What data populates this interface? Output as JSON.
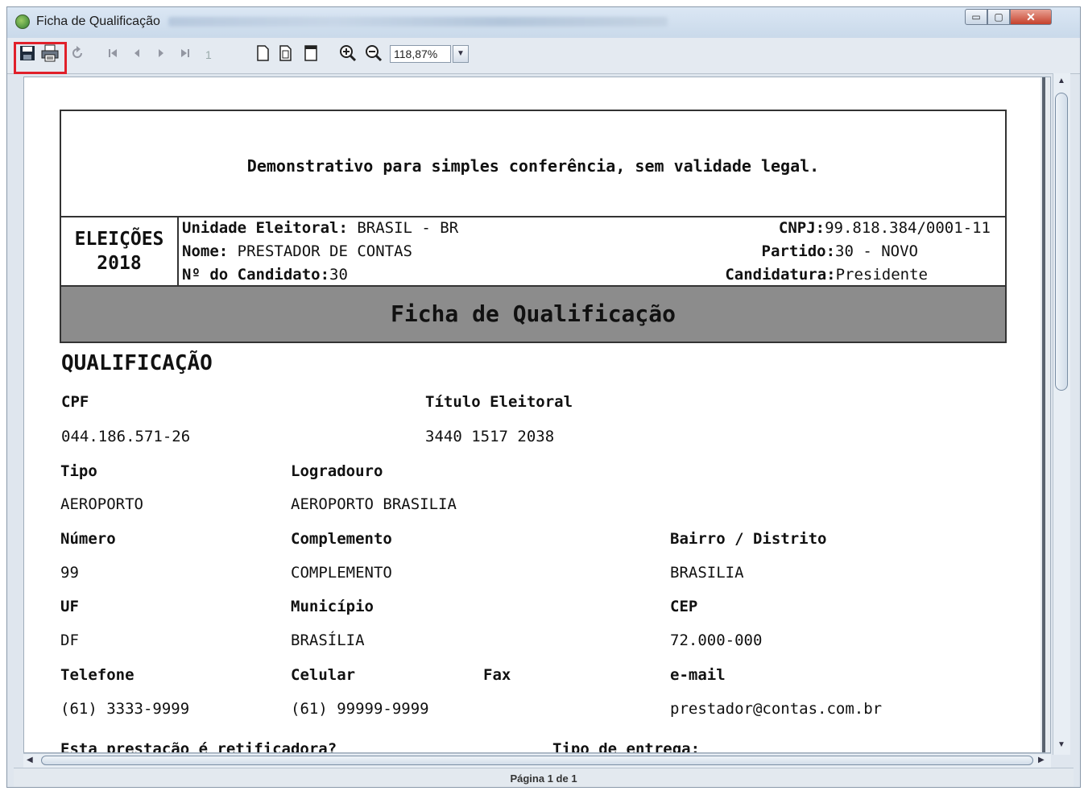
{
  "window": {
    "title": "Ficha de Qualificação",
    "controls": {
      "minimize": "▭",
      "maximize": "▢",
      "close": "✕"
    }
  },
  "toolbar": {
    "page_number": "1",
    "zoom": "118,87%",
    "zoom_arrow": "▼"
  },
  "report": {
    "notice": "Demonstrativo para simples conferência, sem validade legal.",
    "election_line1": "ELEIÇÕES",
    "election_line2": "2018",
    "unidade_label": "Unidade Eleitoral:",
    "unidade_value": "BRASIL - BR",
    "nome_label": "Nome:",
    "nome_value": "PRESTADOR DE CONTAS",
    "candidato_label": "Nº do Candidato:",
    "candidato_value": "30",
    "cnpj_label": "CNPJ:",
    "cnpj_value": "99.818.384/0001-11",
    "partido_label": "Partido:",
    "partido_value": "30 - NOVO",
    "candidatura_label": "Candidatura:",
    "candidatura_value": "Presidente",
    "form_title": "Ficha de Qualificação",
    "section_title": "QUALIFICAÇÃO",
    "fields": {
      "cpf_label": "CPF",
      "cpf_value": "044.186.571-26",
      "titulo_label": "Título Eleitoral",
      "titulo_value": "3440 1517 2038",
      "tipo_label": "Tipo",
      "tipo_value": "AEROPORTO",
      "logradouro_label": "Logradouro",
      "logradouro_value": "AEROPORTO BRASILIA",
      "numero_label": "Número",
      "numero_value": "99",
      "complemento_label": "Complemento",
      "complemento_value": "COMPLEMENTO",
      "bairro_label": "Bairro / Distrito",
      "bairro_value": "BRASILIA",
      "uf_label": "UF",
      "uf_value": "DF",
      "municipio_label": "Município",
      "municipio_value": "BRASÍLIA",
      "cep_label": "CEP",
      "cep_value": "72.000-000",
      "telefone_label": "Telefone",
      "telefone_value": "(61) 3333-9999",
      "celular_label": "Celular",
      "celular_value": "(61) 99999-9999",
      "fax_label": "Fax",
      "email_label": "e-mail",
      "email_value": "prestador@contas.com.br",
      "retificadora_label": "Esta prestação é retificadora?",
      "entrega_label": "Tipo de entrega:"
    }
  },
  "status": {
    "page_info": "Página 1 de 1"
  },
  "icons": {
    "app": "app-icon",
    "save": "save-icon",
    "print": "print-icon",
    "refresh": "refresh-icon",
    "first": "first-page-icon",
    "prev": "previous-page-icon",
    "next": "next-page-icon",
    "last": "last-page-icon",
    "single": "single-page-icon",
    "double": "two-page-icon",
    "fit": "fit-page-icon",
    "zoom_in": "zoom-in-icon",
    "zoom_out": "zoom-out-icon"
  },
  "colors": {
    "highlight": "#e0202a",
    "form_band": "#8c8c8c"
  }
}
